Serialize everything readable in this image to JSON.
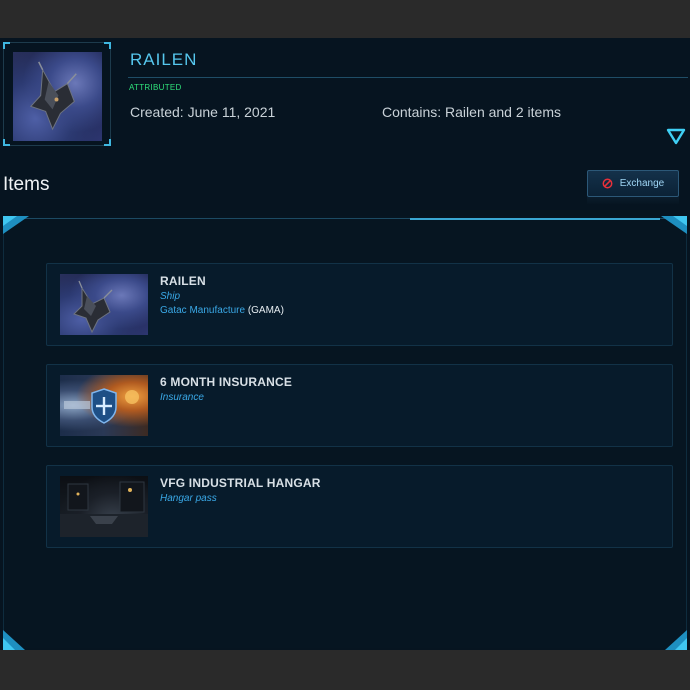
{
  "package": {
    "title": "RAILEN",
    "status": "ATTRIBUTED",
    "created": "Created: June 11, 2021",
    "contains": "Contains: Railen and 2 items",
    "thumbnail": "railen-ship-image"
  },
  "items_section": {
    "heading": "Items",
    "exchange_label": "Exchange"
  },
  "items": [
    {
      "name": "RAILEN",
      "type": "Ship",
      "manufacturer": "Gatac Manufacture",
      "manufacturer_code": "GAMA",
      "image": "railen-ship-image"
    },
    {
      "name": "6 MONTH INSURANCE",
      "type": "Insurance",
      "image": "insurance-shield-image"
    },
    {
      "name": "VFG INDUSTRIAL HANGAR",
      "type": "Hangar pass",
      "image": "hangar-interior-image"
    }
  ],
  "colors": {
    "accent": "#56c7ee",
    "status_green": "#2fe07a",
    "link_blue": "#3aa8e6",
    "background": "#061420"
  }
}
